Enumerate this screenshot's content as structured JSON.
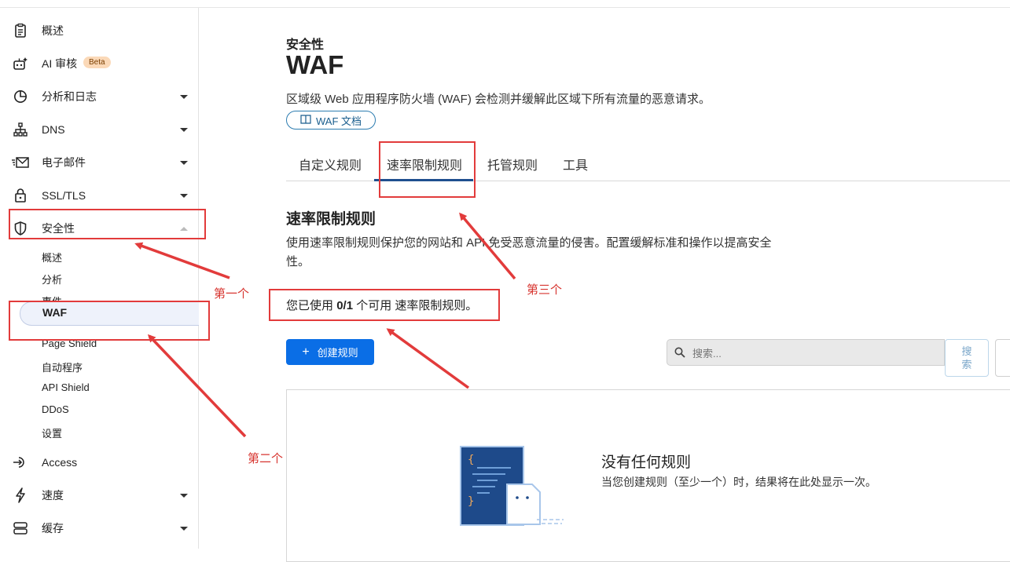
{
  "sidebar": {
    "items": [
      {
        "label": "概述",
        "icon": "clipboard-icon"
      },
      {
        "label": "AI 审核",
        "icon": "robot-icon",
        "badge": "Beta"
      },
      {
        "label": "分析和日志",
        "icon": "pie-chart-icon"
      },
      {
        "label": "DNS",
        "icon": "network-icon"
      },
      {
        "label": "电子邮件",
        "icon": "mail-icon"
      },
      {
        "label": "SSL/TLS",
        "icon": "lock-icon"
      },
      {
        "label": "安全性",
        "icon": "shield-icon"
      },
      {
        "label": "Access",
        "icon": "access-icon"
      },
      {
        "label": "速度",
        "icon": "lightning-icon"
      },
      {
        "label": "缓存",
        "icon": "cache-icon"
      }
    ],
    "security_sub": [
      "概述",
      "分析",
      "事件",
      "WAF",
      "Page Shield",
      "自动程序",
      "API Shield",
      "DDoS",
      "设置"
    ]
  },
  "main": {
    "breadcrumb": "安全性",
    "title": "WAF",
    "description": "区域级 Web 应用程序防火墙 (WAF) 会检测并缓解此区域下所有流量的恶意请求。",
    "docs_button": "WAF 文档",
    "tabs": [
      "自定义规则",
      "速率限制规则",
      "托管规则",
      "工具"
    ],
    "active_tab": "速率限制规则",
    "section_title": "速率限制规则",
    "section_desc": "使用速率限制规则保护您的网站和 API 免受恶意流量的侵害。配置缓解标准和操作以提高安全性。",
    "usage_prefix": "您已使用",
    "usage_count": "0/1",
    "usage_suffix": "个可用 速率限制规则。",
    "create_button": "创建规则",
    "search_placeholder": "搜索...",
    "search_button": "搜索",
    "empty_title": "没有任何规则",
    "empty_desc": "当您创建规则（至少一个）时，结果将在此处显示一次。"
  },
  "annotations": {
    "first": "第一个",
    "second": "第二个",
    "third": "第三个",
    "color": "#e23b3b"
  },
  "colors": {
    "primary": "#0a6ee6",
    "active_tab": "#1f4f8f",
    "beta_badge": "#fbd9b8"
  }
}
